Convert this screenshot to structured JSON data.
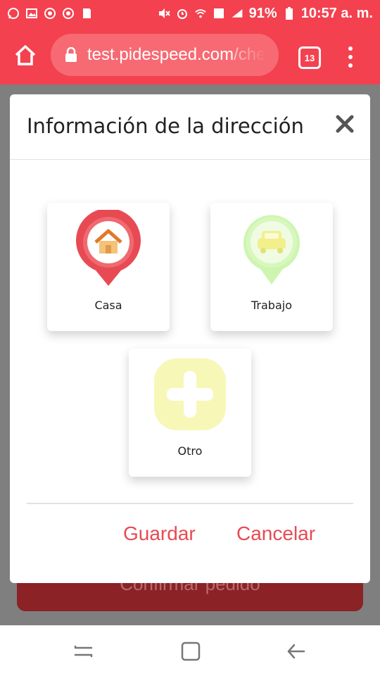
{
  "status_bar": {
    "battery": "91%",
    "time": "10:57 a. m."
  },
  "browser": {
    "url_main": "test.pidespeed.com",
    "url_rest": "/che",
    "tab_count": "13"
  },
  "background": {
    "confirm_label": "Confirmar pedido"
  },
  "modal": {
    "title": "Información de la dirección",
    "options": [
      {
        "label": "Casa",
        "icon": "home-pin-icon",
        "color": "#e84a53"
      },
      {
        "label": "Trabajo",
        "icon": "car-pin-icon",
        "color": "#cdf5b0"
      },
      {
        "label": "Otro",
        "icon": "plus-icon",
        "color": "#f7f7b8"
      }
    ],
    "save_label": "Guardar",
    "cancel_label": "Cancelar"
  },
  "colors": {
    "brand": "#f4414f",
    "action": "#e84a53"
  }
}
